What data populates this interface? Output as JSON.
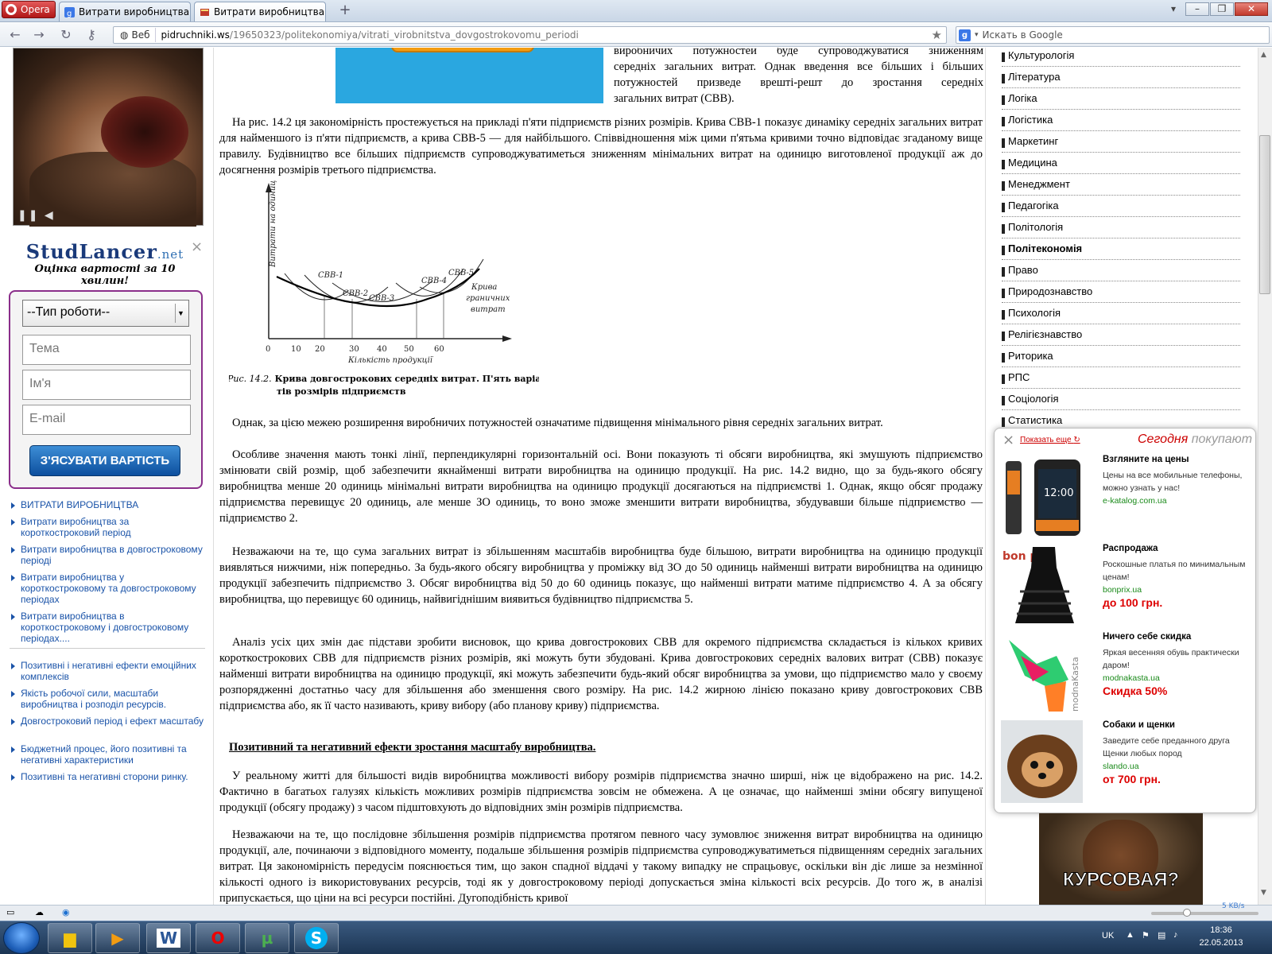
{
  "browser": {
    "menu_label": "Opera",
    "tabs": [
      {
        "label": "Витрати виробництва ..."
      },
      {
        "label": "Витрати виробництва ..."
      }
    ],
    "address": {
      "badge": "Веб",
      "url_host": "pidruchniki.ws",
      "url_path": "/19650323/politekonomiya/vitrati_virobnitstva_dovgostrokovomu_periodi"
    },
    "search_placeholder": "Искать в Google"
  },
  "left_sidebar": {
    "studlancer_logo": "StudLancer",
    "studlancer_logo_suffix": ".net",
    "studlancer_sub": "Оцінка вартості за 10 хвилин!",
    "form": {
      "type_select": "--Тип роботи--",
      "topic_placeholder": "Тема",
      "name_placeholder": "Ім'я",
      "email_placeholder": "E-mail",
      "submit": "З'ЯСУВАТИ ВАРТІСТЬ"
    },
    "links_group1": [
      "ВИТРАТИ ВИРОБНИЦТВА",
      "Витрати виробництва за короткостроковий період",
      "Витрати виробництва в довгостроковому періоді",
      "Витрати виробництва у короткостроковому та довгостроковому періодах",
      "Витрати виробництва в короткостроковому і довгостроковому періодах...."
    ],
    "links_group2": [
      "Позитивні і негативні ефекти емоційних комплексів",
      "Якість робочої сили, масштаби виробництва і розподіл ресурсів.",
      "Довгостроковий період і ефект масштабу",
      "Бюджетний процес, його позитивні та негативні характеристики",
      "Позитивні та негативні сторони ринку."
    ]
  },
  "article": {
    "intro_lines": [
      "виробничих потужностей буде супроводжуватися зниженням",
      "середніх загальних витрат. Однак введення все більших і більших",
      "потужностей призведе врешті-решт до зростання середніх",
      "загальних витрат (СВВ)."
    ],
    "para1": "На рис. 14.2 ця закономірність простежується на прикладі п'яти підприємств різних розмірів. Крива СВВ-1 показує динаміку середніх загальних витрат для найменшого із п'яти підприємств, а крива СВВ-5 — для найбільшого. Співвідношення між цими п'ятьма кривими точно відповідає згаданому вище правилу. Будівництво все більших підприємств супроводжуватиметься зниженням мінімальних витрат на одиницю виготовленої продукції аж до досягнення розмірів третього підприємства.",
    "figure": {
      "ylabel": "Витрати на одиницю продукції",
      "xlabel": "Кількість продукції",
      "xticks": [
        "0",
        "10",
        "20",
        "30",
        "40",
        "50",
        "60"
      ],
      "curve_labels": [
        "СВВ-1",
        "СВВ-2",
        "СВВ-3",
        "СВВ-4",
        "СВВ-5"
      ],
      "envelope_label_1": "Крива",
      "envelope_label_2": "граничних",
      "envelope_label_3": "витрат",
      "caption_prefix": "Рис. 14.2.",
      "caption_line1": "Крива довгострокових середніх витрат. П'ять варіан-",
      "caption_line2": "тів розмірів підприємств"
    },
    "para2": "Однак, за цією межею розширення виробничих потужностей означатиме підвищення мінімального рівня середніх загальних витрат.",
    "para3": "Особливе значення мають тонкі лінії, перпендикулярні горизонтальній осі. Вони показують ті обсяги виробництва, які змушують підприємство змінювати свій розмір, щоб забезпечити якнайменші витрати виробництва на одиницю продукції. На рис. 14.2 видно, що за будь-якого обсягу виробництва менше 20 одиниць мінімальні витрати виробництва на одиницю продукції досягаються на підприємстві 1. Однак, якщо обсяг продажу підприємства перевищує 20 одиниць, але менше ЗО одиниць, то воно зможе зменшити витрати виробництва, збудувавши більше підприємство — підприємство 2.",
    "para4": "Незважаючи на те, що сума загальних витрат із збільшенням масштабів виробництва буде більшою, витрати виробництва на одиницю продукції виявляться нижчими, ніж попередньо. За будь-якого обсягу виробництва у проміжку від ЗО до 50 одиниць найменші витрати виробництва на одиницю продукції забезпечить підприємство 3. Обсяг виробництва від 50 до 60 одиниць показує, що найменші витрати матиме підприємство 4. А за обсягу виробництва, що перевищує 60 одиниць, найвигіднішим виявиться будівництво підприємства 5.",
    "para5": "Аналіз усіх цих змін дає підстави зробити висновок, що крива довгострокових СВВ для окремого підприємства складається із кількох кривих короткострокових СВВ для підприємств різних розмірів, які можуть бути збудовані. Крива довгострокових середніх валових витрат (СВВ) показує найменші витрати виробництва на одиницю продукції, які можуть забезпечити будь-який обсяг виробництва за умови, що підприємство мало у своєму розпорядженні достатньо часу для збільшення або зменшення свого розміру. На рис. 14.2 жирною лінією показано криву довгострокових СВВ підприємства або, як її часто називають, криву вибору (або планову криву) підприємства.",
    "heading": "Позитивний та негативний ефекти зростання масштабу виробництва.",
    "para6": "У реальному житті для більшості видів виробництва можливості вибору розмірів підприємства значно ширші, ніж це відображено на рис. 14.2. Фактично в багатьох галузях кількість можливих розмірів підприємства зовсім не обмежена. А це означає, що найменші зміни обсягу випущеної продукції (обсягу продажу) з часом підштовхують до відповідних змін розмірів підприємства.",
    "para7": "Незважаючи на те, що послідовне збільшення розмірів підприємства протягом певного часу зумовлює зниження витрат виробництва на одиницю продукції, але, починаючи з відповідного моменту, подальше збільшення розмірів підприємства супроводжуватиметься підвищенням середніх загальних витрат. Ця закономірність передусім пояснюється тим, що закон спадної віддачі у такому випадку не спрацьовує, оскільки він діє лише за незмінної кількості одного із використовуваних ресурсів, тоді як у довгостроковому періоді допускається зміна кількості всіх ресурсів. До того ж, в аналізі припускається, що ціни на всі ресурси постійні. Дугоподібність кривої"
  },
  "right_sidebar": {
    "categories": [
      {
        "label": "Культурологія",
        "active": false
      },
      {
        "label": "Література",
        "active": false
      },
      {
        "label": "Логіка",
        "active": false
      },
      {
        "label": "Логістика",
        "active": false
      },
      {
        "label": "Маркетинг",
        "active": false
      },
      {
        "label": "Медицина",
        "active": false
      },
      {
        "label": "Менеджмент",
        "active": false
      },
      {
        "label": "Педагогіка",
        "active": false
      },
      {
        "label": "Політологія",
        "active": false
      },
      {
        "label": "Політекономія",
        "active": true
      },
      {
        "label": "Право",
        "active": false
      },
      {
        "label": "Природознавство",
        "active": false
      },
      {
        "label": "Психологія",
        "active": false
      },
      {
        "label": "Релігієзнавство",
        "active": false
      },
      {
        "label": "Риторика",
        "active": false
      },
      {
        "label": "РПС",
        "active": false
      },
      {
        "label": "Соціологія",
        "active": false
      },
      {
        "label": "Статистика",
        "active": false
      }
    ],
    "popup": {
      "more": "Показать еще",
      "title_red": "Сегодня",
      "title_gray": "покупают",
      "items": [
        {
          "title": "Взгляните на цены",
          "desc": "Цены на все мобильные телефоны, можно узнать у нас!",
          "url": "e-katalog.com.ua",
          "price": ""
        },
        {
          "title": "Распродажа",
          "desc": "Роскошные платья по минимальным ценам!",
          "url": "bonprix.ua",
          "price": "до 100 грн."
        },
        {
          "title": "Ничего себе скидка",
          "desc": "Яркая весенняя обувь практически даром!",
          "url": "modnakasta.ua",
          "price": "Скидка 50%"
        },
        {
          "title": "Собаки и щенки",
          "desc": "Заведите себе преданного друга Щенки любых пород",
          "url": "slando.ua",
          "price": "от 700 грн."
        }
      ],
      "img_labels": {
        "phone_time": "12:00",
        "bonprix": "bon prix",
        "modnakasta": "modnaKasta"
      }
    },
    "kursova": "КУРСОВАЯ?"
  },
  "status": {
    "speed": "5 KB/s"
  },
  "taskbar": {
    "lang": "UK",
    "time": "18:36",
    "date": "22.05.2013"
  },
  "colors": {
    "link": "#1a53a8",
    "form_border": "#8a2e8a",
    "button_blue": "#0d4f9e",
    "popup_red": "#cc0000",
    "ad_blue": "#2aa7e0"
  }
}
